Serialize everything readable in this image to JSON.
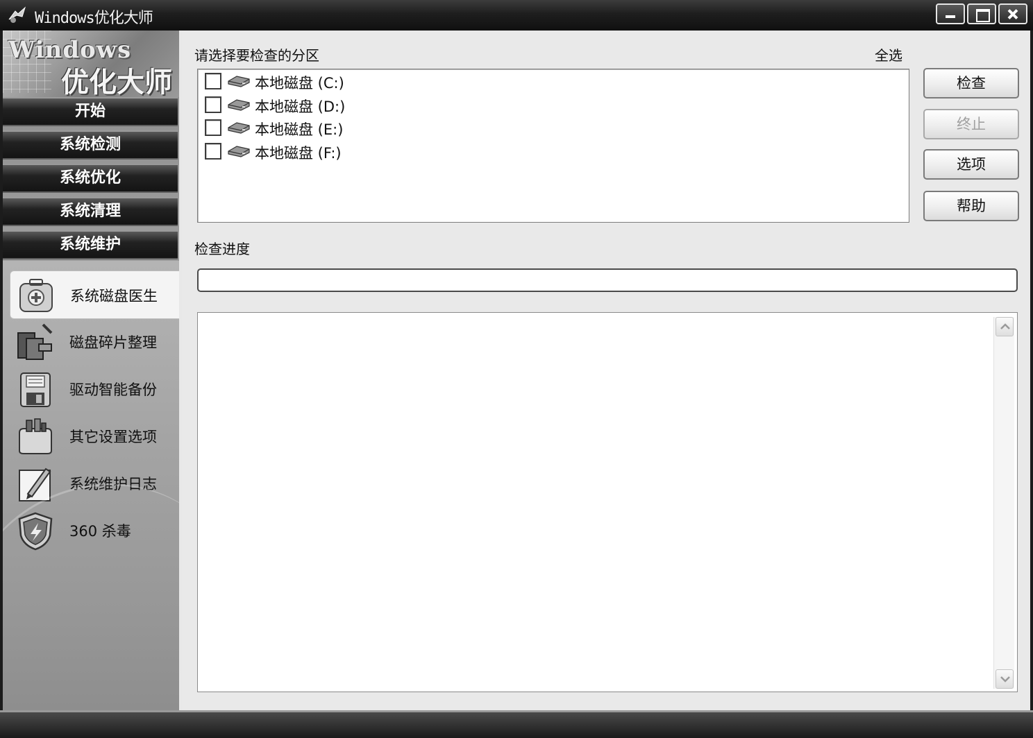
{
  "window": {
    "title": "Windows优化大师"
  },
  "logo": {
    "line1": "Windows",
    "line2": "优化大师"
  },
  "nav": [
    {
      "label": "开始"
    },
    {
      "label": "系统检测"
    },
    {
      "label": "系统优化"
    },
    {
      "label": "系统清理"
    },
    {
      "label": "系统维护"
    }
  ],
  "subnav": [
    {
      "label": "系统磁盘医生",
      "icon": "medical-kit-icon",
      "active": true
    },
    {
      "label": "磁盘碎片整理",
      "icon": "defrag-icon",
      "active": false
    },
    {
      "label": "驱动智能备份",
      "icon": "floppy-disk-icon",
      "active": false
    },
    {
      "label": "其它设置选项",
      "icon": "toolbox-icon",
      "active": false
    },
    {
      "label": "系统维护日志",
      "icon": "pen-notepad-icon",
      "active": false
    },
    {
      "label": "360 杀毒",
      "icon": "shield-icon",
      "active": false
    }
  ],
  "main": {
    "partition_label": "请选择要检查的分区",
    "select_all": "全选",
    "drives": [
      {
        "label": "本地磁盘 (C:)",
        "checked": false
      },
      {
        "label": "本地磁盘 (D:)",
        "checked": false
      },
      {
        "label": "本地磁盘 (E:)",
        "checked": false
      },
      {
        "label": "本地磁盘 (F:)",
        "checked": false
      }
    ],
    "buttons": {
      "check": "检查",
      "stop": "终止",
      "options": "选项",
      "help": "帮助"
    },
    "progress_label": "检查进度",
    "progress_value": 0
  }
}
